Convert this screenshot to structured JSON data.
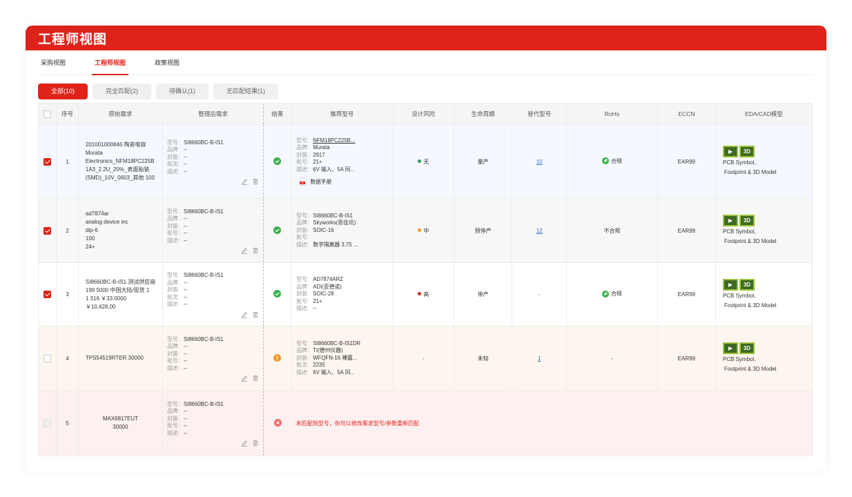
{
  "header": {
    "title": "工程师视图"
  },
  "tabs": [
    "采购视图",
    "工程师视图",
    "政策视图"
  ],
  "filters": [
    "全部(10)",
    "完全匹配(2)",
    "待确认(1)",
    "无匹配结果(1)"
  ],
  "columns": {
    "seq": "序号",
    "original": "原始需求",
    "cleaned": "整理后需求",
    "result": "结果",
    "recommended": "推荐型号",
    "risk": "设计风险",
    "lifecycle": "生命周期",
    "alternatives": "替代型号",
    "rohs": "RoHs",
    "eccn": "ECCN",
    "eda": "EDA/CAD模型"
  },
  "labels": {
    "model": "型号:",
    "brand": "品牌:",
    "package": "封装:",
    "batch": "批号:",
    "lot": "批次:",
    "desc": "描述:",
    "datasheet": "数据手册",
    "eda_line1": "PCB Symbol,",
    "eda_line2": "Footprint & 3D Model"
  },
  "rows": [
    {
      "checked": true,
      "seq": "1",
      "original": [
        "201001000846 陶瓷电容",
        "Murata",
        "Electronics_NFM18PC225B",
        "1A3_2.2U_20%_表面贴装",
        "(SMD)_10V_0603_其他 100"
      ],
      "cleaned": {
        "model": "SI8660BC-B-IS1",
        "brand": "--",
        "package": "--",
        "lot": "--",
        "desc": "--"
      },
      "result": "ok",
      "rec": {
        "model": "NFM18PC225B...",
        "brand": "Murata",
        "package": "2917",
        "batch": "21+",
        "desc": "6V 输入、5A 同..."
      },
      "risk": "无",
      "risk_color": "#1aa35a",
      "lifecycle": "量产",
      "alternatives": "10",
      "rohs": "合规",
      "eccn": "EAR99"
    },
    {
      "checked": true,
      "seq": "2",
      "original": [
        "ad7874ar",
        "analog device inc",
        "dip-6",
        "100",
        "24+"
      ],
      "cleaned": {
        "model": "SI8660BC-B-IS1",
        "brand": "--",
        "package": "--",
        "batch": "--",
        "desc": "--"
      },
      "result": "ok",
      "rec": {
        "model": "SI8660BC-B-IS1",
        "brand": "Skyworks(思佳讯)",
        "package": "SOIC-16",
        "batch": "",
        "desc": "数字隔离器 3.75 ..."
      },
      "risk": "中",
      "risk_color": "#f59a23",
      "lifecycle": "预停产",
      "alternatives": "12",
      "rohs": "不合规",
      "eccn": "EAR99"
    },
    {
      "checked": true,
      "seq": "3",
      "original": [
        "SI8660BC-B-IS1 测试供应商",
        "199 5000 中国大陆/现货 1",
        "1 316 ￥33.0000",
        "￥10,428.00"
      ],
      "cleaned": {
        "model": "SI8660BC-B-IS1",
        "brand": "--",
        "package": "--",
        "lot": "--",
        "desc": "--"
      },
      "result": "ok",
      "rec": {
        "model": "AD7874ARZ",
        "brand": "ADI(亚德诺)",
        "package": "SOIC-28",
        "batch": "21+",
        "desc": "--"
      },
      "risk": "高",
      "risk_color": "#e0231a",
      "lifecycle": "停产",
      "alternatives": "-",
      "rohs": "合规",
      "eccn": "EAR99"
    },
    {
      "checked": false,
      "seq": "4",
      "original": [
        "TPS54519RTER 30000"
      ],
      "cleaned": {
        "model": "SI8660BC-B-IS1",
        "brand": "--",
        "package": "--",
        "batch": "--",
        "desc": "--"
      },
      "result": "warn",
      "rec": {
        "model_main": "SI8660BC-B-IS1",
        "model_suffix": "DR",
        "brand": "TI(德州仪器)",
        "package": "WFQFN-16 裸露...",
        "lot": "2235",
        "desc": "6V 输入、5A 同..."
      },
      "risk": "-",
      "lifecycle": "未知",
      "alternatives": "1",
      "rohs": "-",
      "eccn": "EAR99"
    },
    {
      "checked": false,
      "seq": "5",
      "original": [
        "MAX6817EUT",
        "30000"
      ],
      "cleaned": {
        "model": "SI8660BC-B-IS1",
        "brand": "--",
        "package": "--",
        "batch": "--",
        "desc": "--"
      },
      "result": "error",
      "message": "未匹配到型号，你可以修改需求型号/参数重新匹配"
    }
  ]
}
